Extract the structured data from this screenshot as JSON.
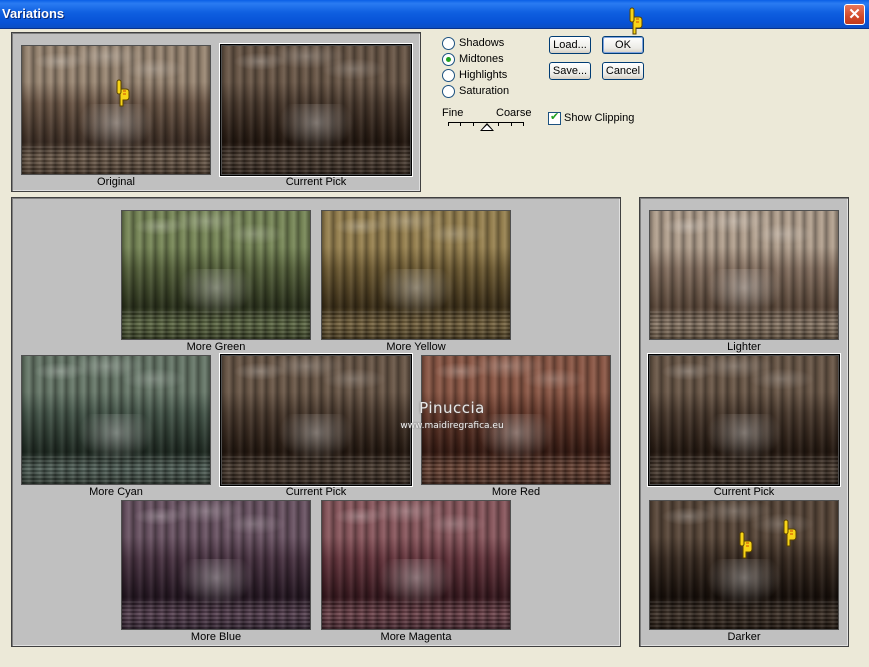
{
  "window": {
    "title": "Variations",
    "close_glyph": "✕"
  },
  "preview": {
    "original_label": "Original",
    "current_label": "Current Pick"
  },
  "options": {
    "radios": [
      {
        "label": "Shadows",
        "checked": false
      },
      {
        "label": "Midtones",
        "checked": true
      },
      {
        "label": "Highlights",
        "checked": false
      },
      {
        "label": "Saturation",
        "checked": false
      }
    ],
    "fine_label": "Fine",
    "coarse_label": "Coarse",
    "slider_level": 0.5,
    "show_clipping_label": "Show Clipping",
    "show_clipping_checked": true
  },
  "buttons": {
    "load": "Load...",
    "ok": "OK",
    "save": "Save...",
    "cancel": "Cancel"
  },
  "color_grid": {
    "more_green": "More Green",
    "more_yellow": "More Yellow",
    "more_cyan": "More Cyan",
    "current_pick": "Current Pick",
    "more_red": "More Red",
    "more_blue": "More Blue",
    "more_magenta": "More Magenta"
  },
  "brightness": {
    "lighter": "Lighter",
    "current_pick": "Current Pick",
    "darker": "Darker"
  },
  "watermark": {
    "name": "Pinuccia",
    "url": "www.maidiregrafica.eu"
  },
  "colors": {
    "title_bar": "#0a5fe6",
    "dialog_bg": "#ece9d8",
    "panel_bg": "#c0c0c0",
    "hand_pointer": "#f7d417"
  },
  "icons": [
    "close-icon",
    "hand-pointer-icon"
  ]
}
